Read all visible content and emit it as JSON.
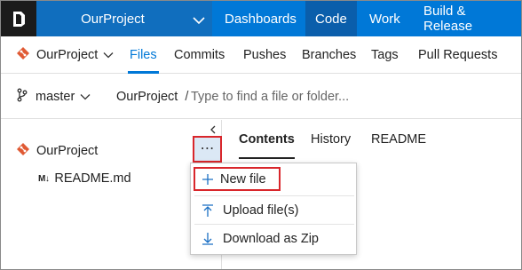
{
  "topnav": {
    "project": "OurProject",
    "items": [
      "Dashboards",
      "Code",
      "Work",
      "Build & Release"
    ],
    "active_item": "Code",
    "brand_color": "#0078d7"
  },
  "subnav": {
    "project": "OurProject",
    "tabs": [
      "Files",
      "Commits",
      "Pushes",
      "Branches",
      "Tags",
      "Pull Requests"
    ],
    "active_tab": "Files"
  },
  "pathbar": {
    "branch": "master",
    "root": "OurProject",
    "separator": "/",
    "placeholder": "Type to find a file or folder..."
  },
  "tree": {
    "root": "OurProject",
    "file_icon": "M↓",
    "files": [
      "README.md"
    ],
    "more_label": "⋯"
  },
  "content_tabs": [
    "Contents",
    "History",
    "README"
  ],
  "context_menu": {
    "items": [
      {
        "label": "New file",
        "icon": "plus-icon"
      },
      {
        "label": "Upload file(s)",
        "icon": "upload-icon"
      },
      {
        "label": "Download as Zip",
        "icon": "download-icon"
      }
    ]
  },
  "highlight_color": "#d9262b"
}
